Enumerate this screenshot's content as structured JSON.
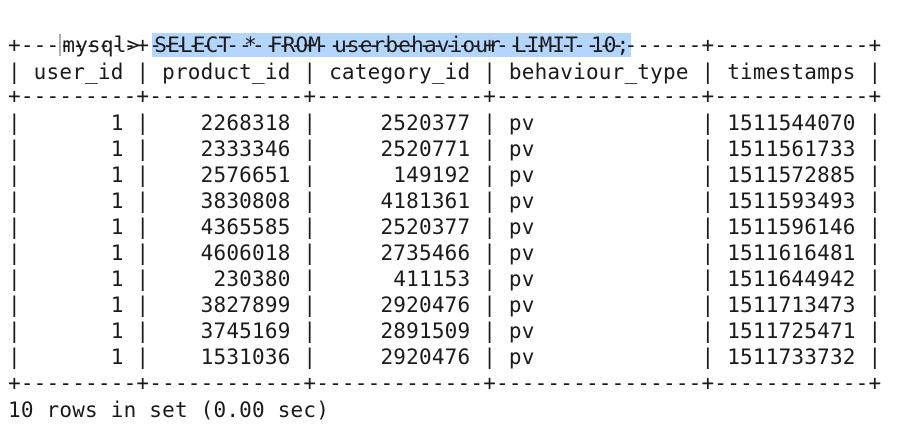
{
  "terminal": {
    "prompt": "mysql> ",
    "query": "SELECT * FROM userbehaviour LIMIT 10;",
    "border_line": "+---------+------------+-------------+----------------+------------+",
    "header_line": "| user_id | product_id | category_id | behaviour_type | timestamps |",
    "rows": [
      "|       1 |    2268318 |     2520377 | pv             | 1511544070 |",
      "|       1 |    2333346 |     2520771 | pv             | 1511561733 |",
      "|       1 |    2576651 |      149192 | pv             | 1511572885 |",
      "|       1 |    3830808 |     4181361 | pv             | 1511593493 |",
      "|       1 |    4365585 |     2520377 | pv             | 1511596146 |",
      "|       1 |    4606018 |     2735466 | pv             | 1511616481 |",
      "|       1 |     230380 |      411153 | pv             | 1511644942 |",
      "|       1 |    3827899 |     2920476 | pv             | 1511713473 |",
      "|       1 |    3745169 |     2891509 | pv             | 1511725471 |",
      "|       1 |    1531036 |     2920476 | pv             | 1511733732 |"
    ],
    "footer": "10 rows in set (0.00 sec)",
    "highlight_color": "#b4d5fe"
  }
}
